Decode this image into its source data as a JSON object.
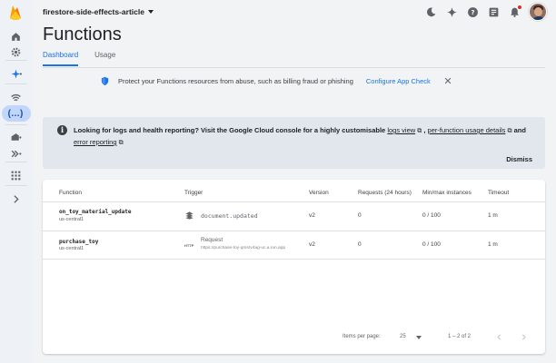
{
  "header": {
    "project": "firestore-side-effects-article",
    "title": "Functions"
  },
  "tabs": [
    {
      "label": "Dashboard",
      "active": true
    },
    {
      "label": "Usage",
      "active": false
    }
  ],
  "banner": {
    "text": "Protect your Functions resources from abuse, such as billing fraud or phishing",
    "link": "Configure App Check"
  },
  "info": {
    "text_before": "Looking for logs and health reporting? Visit the Google Cloud console for a highly customisable ",
    "link_logs": "logs view",
    "sep1": " , ",
    "link_usage": "per-function usage details",
    "sep2": " and ",
    "link_errors": "error reporting",
    "dismiss": "Dismiss"
  },
  "table": {
    "columns": [
      "Function",
      "Trigger",
      "Version",
      "Requests (24 hours)",
      "Min/max instances",
      "Timeout"
    ],
    "rows": [
      {
        "name": "on_toy_material_update",
        "region": "us-central1",
        "trigger": "document.updated",
        "trigger_url": "",
        "version": "v2",
        "requests": "0",
        "instances": "0 / 100",
        "timeout": "1 m"
      },
      {
        "name": "purchase_toy",
        "region": "us-central1",
        "trigger": "Request",
        "trigger_url": "https://purchase-toy-qmsrv4ag-uc.a.run.app",
        "http_label": "HTTP",
        "version": "v2",
        "requests": "0",
        "instances": "0 / 100",
        "timeout": "1 m"
      }
    ]
  },
  "pagination": {
    "items_per_page_label": "Items per page:",
    "items_per_page": "25",
    "range": "1 – 2 of 2"
  },
  "colors": {
    "accent": "#1a73e8",
    "firebase_orange": "#ff9100",
    "rail_active": "#c2d5fb"
  }
}
